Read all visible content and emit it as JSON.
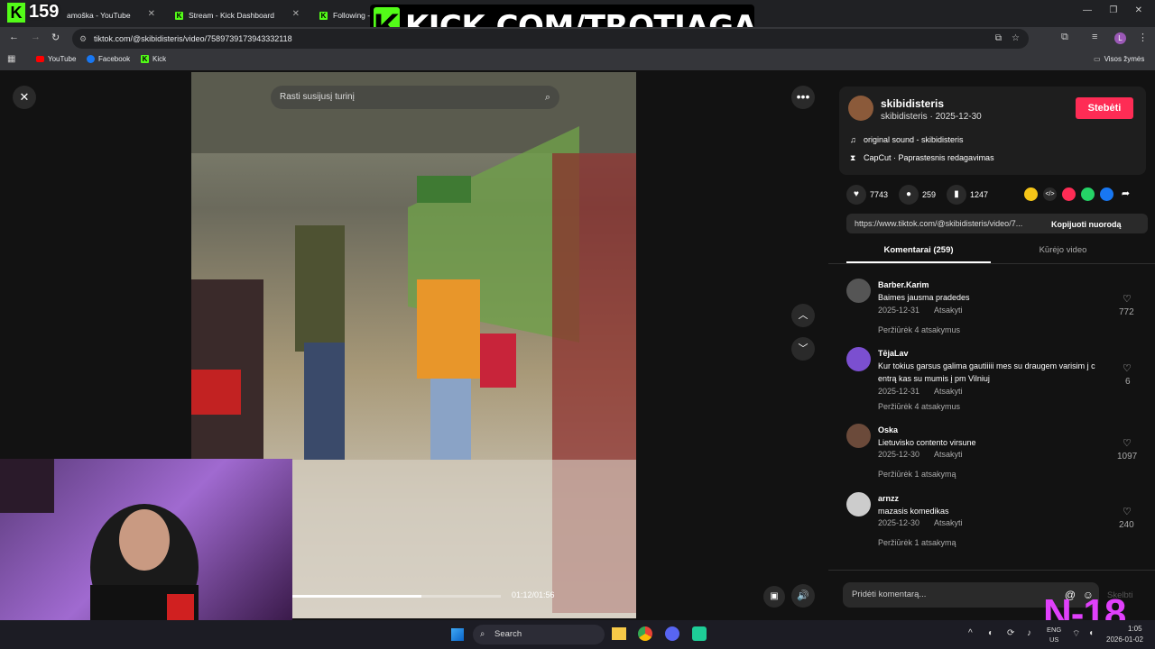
{
  "overlay": {
    "viewer_count": "159",
    "promo_text": "KICK.COM/TROTIAGA",
    "corner_tag": "N-18"
  },
  "browser": {
    "tabs": [
      {
        "label": "amoška - YouTube"
      },
      {
        "label": "Stream - Kick Dashboard"
      },
      {
        "label": "Following - "
      }
    ],
    "url": "tiktok.com/@skibidisteris/video/7589739173943332118",
    "bookmarks": [
      "YouTube",
      "Facebook",
      "Kick"
    ],
    "all_bookmarks": "Visos žymės"
  },
  "video": {
    "search_placeholder": "Rasti susijusį turinį",
    "time": "01:12/01:56",
    "progress": 0.62
  },
  "post": {
    "username": "skibidisteris",
    "subline": "skibidisteris · 2025-12-30",
    "follow_label": "Stebėti",
    "sound": "original sound - skibidisteris",
    "editor": "CapCut · Paprastesnis redagavimas",
    "likes": "7743",
    "comments_count": "259",
    "saves": "1247",
    "link": "https://www.tiktok.com/@skibidisteris/video/7...",
    "copy_label": "Kopijuoti nuorodą",
    "tab_comments": "Komentarai (259)",
    "tab_creator": "Kūrėjo video"
  },
  "comments": [
    {
      "user": "Barber.Karim",
      "text": "Baimes jausma pradedes",
      "date": "2025-12-31",
      "reply": "Atsakyti",
      "likes": "772",
      "more": "Peržiūrėk 4 atsakymus"
    },
    {
      "user": "TējaLav",
      "text": "Kur tokius garsus galima gautiiiii mes su draugem varisim j c",
      "text2": "entrą kas su mumis į pm Vilniuj",
      "date": "2025-12-31",
      "reply": "Atsakyti",
      "likes": "6",
      "more": "Peržiūrėk 4 atsakymus"
    },
    {
      "user": "Oska",
      "text": "Lietuvisko contento virsune",
      "date": "2025-12-30",
      "reply": "Atsakyti",
      "likes": "1097",
      "more": "Peržiūrėk 1 atsakymą"
    },
    {
      "user": "arnzz",
      "text": "mazasis komedikas",
      "date": "2025-12-30",
      "reply": "Atsakyti",
      "likes": "240",
      "more": "Peržiūrėk 1 atsakymą"
    }
  ],
  "composer": {
    "placeholder": "Pridėti komentarą...",
    "post_label": "Skelbti"
  },
  "taskbar": {
    "search": "Search",
    "lang": "ENG",
    "region": "US",
    "time": "1:05",
    "date": "2026-01-02"
  },
  "colors": {
    "accent": "#fe2c55",
    "kick_green": "#53fc18"
  }
}
